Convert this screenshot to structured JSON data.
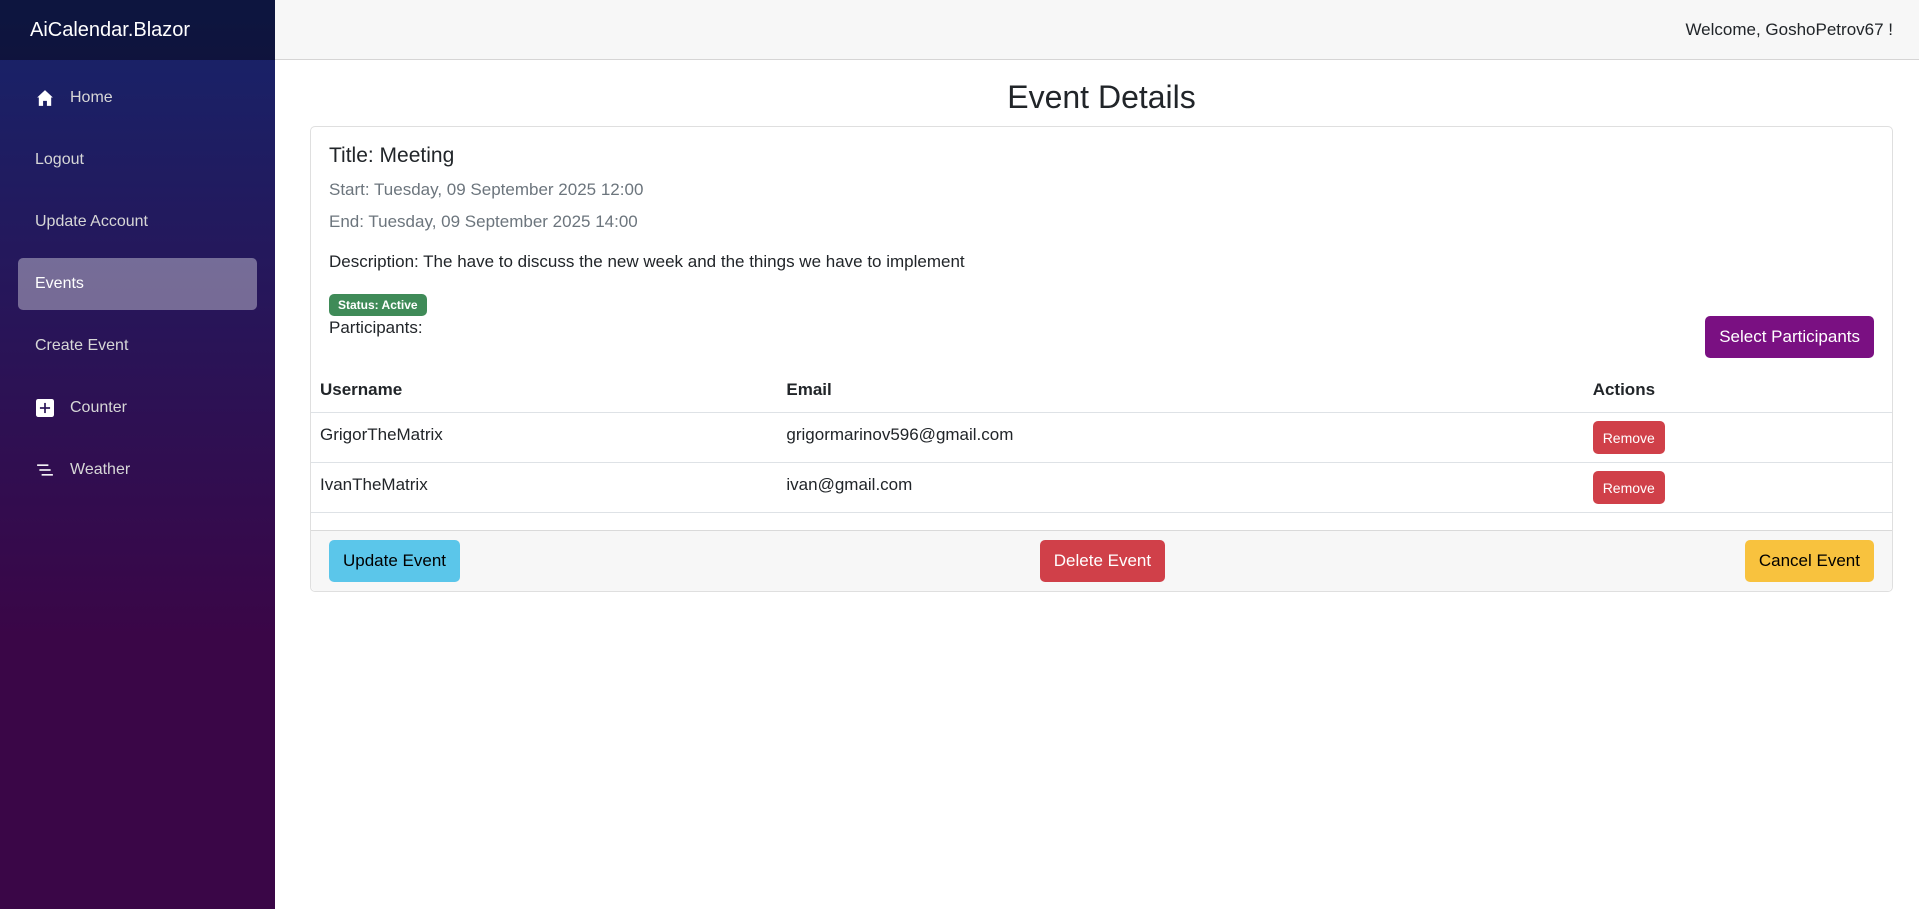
{
  "sidebar": {
    "brand": "AiCalendar.Blazor",
    "items": [
      {
        "label": "Home",
        "icon": "home-icon"
      },
      {
        "label": "Logout",
        "icon": ""
      },
      {
        "label": "Update Account",
        "icon": ""
      },
      {
        "label": "Events",
        "icon": "",
        "active": true
      },
      {
        "label": "Create Event",
        "icon": ""
      },
      {
        "label": "Counter",
        "icon": "plus-square-icon"
      },
      {
        "label": "Weather",
        "icon": "list-icon"
      }
    ]
  },
  "header": {
    "welcome": "Welcome, GoshoPetrov67 !"
  },
  "page": {
    "title": "Event Details"
  },
  "event": {
    "title": "Title: Meeting",
    "start": "Start: Tuesday, 09 September 2025 12:00",
    "end": "End: Tuesday, 09 September 2025 14:00",
    "description": "Description: The have to discuss the new week and the things we have to implement",
    "status": "Status: Active",
    "participants_label": "Participants:",
    "select_participants_label": "Select Participants"
  },
  "participants_table": {
    "headers": [
      "Username",
      "Email",
      "Actions"
    ],
    "rows": [
      {
        "username": "GrigorTheMatrix",
        "email": "grigormarinov596@gmail.com",
        "action": "Remove"
      },
      {
        "username": "IvanTheMatrix",
        "email": "ivan@gmail.com",
        "action": "Remove"
      }
    ]
  },
  "footer": {
    "update_label": "Update Event",
    "delete_label": "Delete Event",
    "cancel_label": "Cancel Event"
  },
  "colors": {
    "sidebar_top": "#16246a",
    "sidebar_bottom": "#3a0647",
    "status_active": "#3f8b58",
    "purple": "#7a1082",
    "info": "#5bc6ea",
    "danger": "#d04049",
    "warning": "#f8c23e"
  }
}
